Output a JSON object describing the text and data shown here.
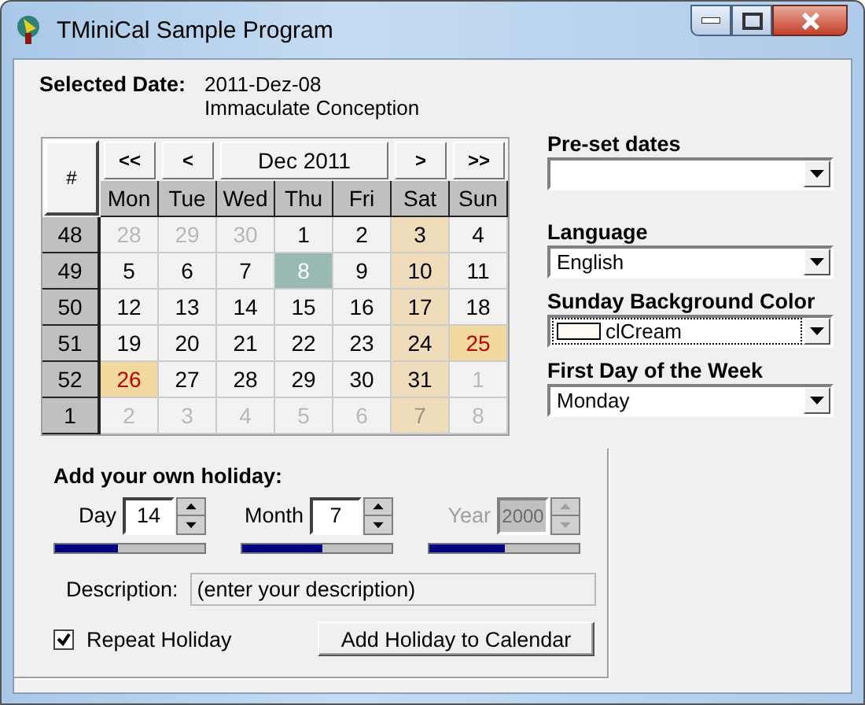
{
  "window": {
    "title": "TMiniCal Sample Program"
  },
  "selected_date": {
    "label": "Selected Date:",
    "date": "2011-Dez-08",
    "holiday": "Immaculate Conception"
  },
  "calendar": {
    "week_header": "#",
    "nav_buttons": [
      "<<",
      "<",
      ">",
      ">>"
    ],
    "month": "Dec 2011",
    "day_names": [
      "Mon",
      "Tue",
      "Wed",
      "Thu",
      "Fri",
      "Sat",
      "Sun"
    ],
    "weeks": [
      {
        "number": "48",
        "days": [
          {
            "text": "28",
            "kind": "muted"
          },
          {
            "text": "29",
            "kind": "muted"
          },
          {
            "text": "30",
            "kind": "muted"
          },
          {
            "text": "1",
            "kind": "day"
          },
          {
            "text": "2",
            "kind": "day"
          },
          {
            "text": "3",
            "kind": "weekend"
          },
          {
            "text": "4",
            "kind": "day"
          }
        ]
      },
      {
        "number": "49",
        "days": [
          {
            "text": "5",
            "kind": "day"
          },
          {
            "text": "6",
            "kind": "day"
          },
          {
            "text": "7",
            "kind": "day"
          },
          {
            "text": "8",
            "kind": "selected"
          },
          {
            "text": "9",
            "kind": "day"
          },
          {
            "text": "10",
            "kind": "weekend"
          },
          {
            "text": "11",
            "kind": "day"
          }
        ]
      },
      {
        "number": "50",
        "days": [
          {
            "text": "12",
            "kind": "day"
          },
          {
            "text": "13",
            "kind": "day"
          },
          {
            "text": "14",
            "kind": "day"
          },
          {
            "text": "15",
            "kind": "day"
          },
          {
            "text": "16",
            "kind": "day"
          },
          {
            "text": "17",
            "kind": "weekend"
          },
          {
            "text": "18",
            "kind": "day"
          }
        ]
      },
      {
        "number": "51",
        "days": [
          {
            "text": "19",
            "kind": "day"
          },
          {
            "text": "20",
            "kind": "day"
          },
          {
            "text": "21",
            "kind": "day"
          },
          {
            "text": "22",
            "kind": "day"
          },
          {
            "text": "23",
            "kind": "day"
          },
          {
            "text": "24",
            "kind": "weekend"
          },
          {
            "text": "25",
            "kind": "holiday"
          }
        ]
      },
      {
        "number": "52",
        "days": [
          {
            "text": "26",
            "kind": "holiday"
          },
          {
            "text": "27",
            "kind": "day"
          },
          {
            "text": "28",
            "kind": "day"
          },
          {
            "text": "29",
            "kind": "day"
          },
          {
            "text": "30",
            "kind": "day"
          },
          {
            "text": "31",
            "kind": "weekend"
          },
          {
            "text": "1",
            "kind": "muted"
          }
        ]
      },
      {
        "number": "1",
        "days": [
          {
            "text": "2",
            "kind": "muted"
          },
          {
            "text": "3",
            "kind": "muted"
          },
          {
            "text": "4",
            "kind": "muted"
          },
          {
            "text": "5",
            "kind": "muted"
          },
          {
            "text": "6",
            "kind": "muted"
          },
          {
            "text": "7",
            "kind": "weekend-muted"
          },
          {
            "text": "8",
            "kind": "muted"
          }
        ]
      }
    ]
  },
  "settings": [
    {
      "label": "Pre-set dates",
      "focused": false
    },
    {
      "label": "Language",
      "value": "English",
      "focused": false
    },
    {
      "label": "Sunday Background Color",
      "value": "clCream",
      "color": "#fffbf0",
      "focused": true
    },
    {
      "label": "First Day of the Week",
      "value": "Monday",
      "focused": false
    }
  ],
  "holiday_form": {
    "title": "Add your own holiday:",
    "spinners": [
      {
        "label": "Day",
        "value": "14",
        "level": 0.42,
        "disabled": false
      },
      {
        "label": "Month",
        "value": "7",
        "level": 0.54,
        "disabled": false
      },
      {
        "label": "Year",
        "value": "2000",
        "level": 0.5,
        "disabled": true
      }
    ],
    "description": {
      "label": "Description:",
      "value": "(enter your description)"
    },
    "repeat": {
      "label": "Repeat Holiday",
      "checked": true
    },
    "button": "Add Holiday to Calendar"
  }
}
